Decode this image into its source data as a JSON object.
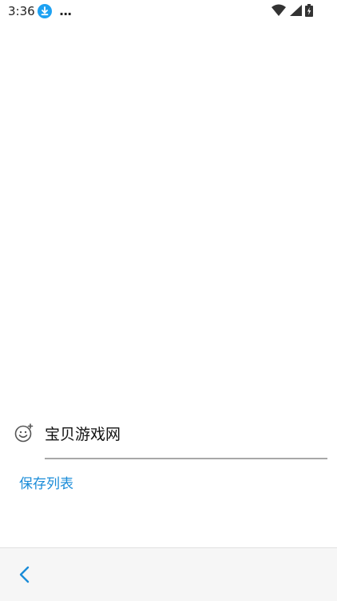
{
  "status_bar": {
    "time": "3:36",
    "more": "...",
    "icons": [
      "download-icon",
      "wifi-icon",
      "signal-icon",
      "battery-icon"
    ],
    "accent": "#1da1f2"
  },
  "form": {
    "name_value": "宝贝游戏网",
    "emoji_icon": "emoji-add-icon"
  },
  "actions": {
    "save_list_label": "保存列表"
  },
  "bottom_bar": {
    "back_icon": "chevron-left-icon"
  },
  "colors": {
    "link": "#1a8cd8",
    "underline": "#a8a8a8",
    "bottom_bar_bg": "#f6f6f6"
  }
}
